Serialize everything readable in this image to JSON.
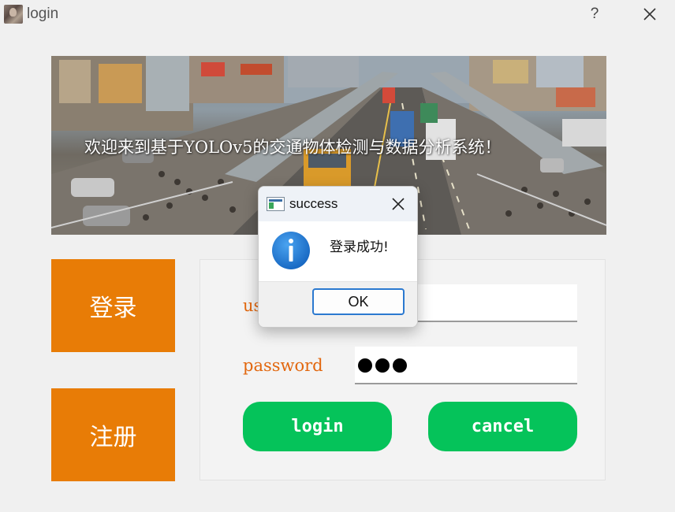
{
  "window": {
    "title": "login",
    "help_label": "?",
    "icon": "app-avatar-icon"
  },
  "banner": {
    "text": "欢迎来到基于YOLOv5的交通物体检测与数据分析系统！"
  },
  "side_nav": {
    "login_label": "登录",
    "register_label": "注册"
  },
  "form": {
    "username_label": "username",
    "username_value": "",
    "password_label": "password",
    "password_masked_count": 3,
    "login_button": "login",
    "cancel_button": "cancel"
  },
  "dialog": {
    "title": "success",
    "message": "登录成功!",
    "ok_button": "OK",
    "icon": "info-icon"
  },
  "colors": {
    "side_button": "#e87c06",
    "action_button": "#05c35a",
    "label_text": "#e2670e",
    "dialog_accent": "#2b79d0",
    "info_icon": "#1976d2"
  }
}
